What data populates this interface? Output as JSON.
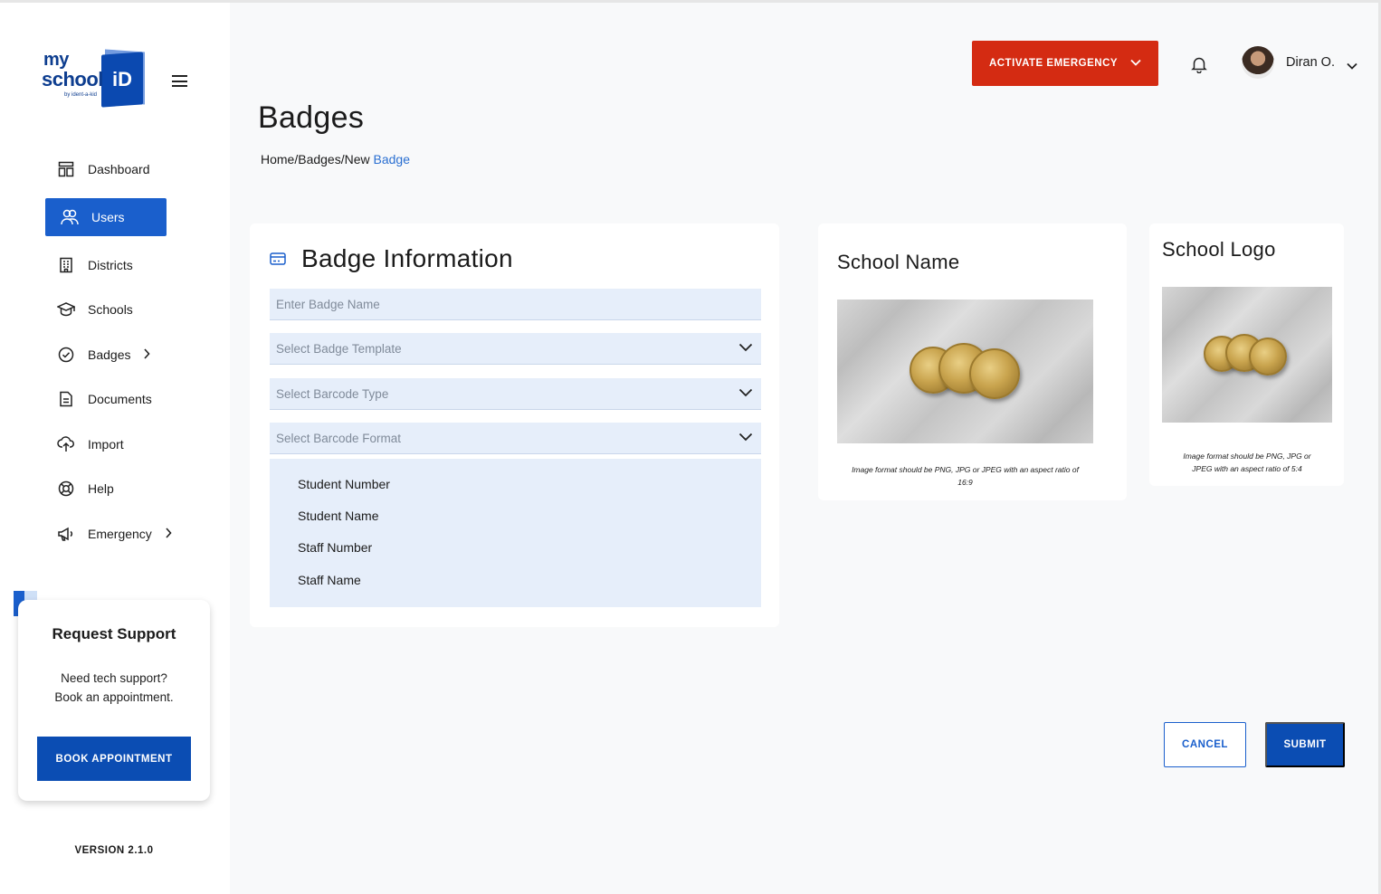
{
  "brand": {
    "logo_my": "my",
    "logo_school": "school",
    "logo_id": "iD",
    "logo_byline": "by ident-a-kid"
  },
  "sidebar": {
    "items": [
      {
        "label": "Dashboard",
        "icon": "dashboard-icon"
      },
      {
        "label": "Users",
        "icon": "users-icon",
        "active": true
      },
      {
        "label": "Districts",
        "icon": "building-icon"
      },
      {
        "label": "Schools",
        "icon": "graduation-cap-icon"
      },
      {
        "label": "Badges",
        "icon": "badge-check-icon",
        "has_submenu": true
      },
      {
        "label": "Documents",
        "icon": "document-icon"
      },
      {
        "label": "Import",
        "icon": "cloud-upload-icon"
      },
      {
        "label": "Help",
        "icon": "lifebuoy-icon"
      },
      {
        "label": "Emergency",
        "icon": "megaphone-icon",
        "has_submenu": true
      }
    ],
    "support": {
      "title": "Request Support",
      "line1": "Need tech support?",
      "line2": "Book an appointment.",
      "button": "BOOK APPOINTMENT"
    },
    "version": "VERSION 2.1.0"
  },
  "header": {
    "emergency_button": "ACTIVATE EMERGENCY",
    "user_name": "Diran O."
  },
  "page": {
    "title": "Badges",
    "breadcrumb": {
      "path": "Home/Badges/New ",
      "current": "Badge"
    }
  },
  "badge_info": {
    "title": "Badge Information",
    "badge_name_placeholder": "Enter Badge Name",
    "template_placeholder": "Select Badge Template",
    "barcode_type_placeholder": "Select Barcode Type",
    "barcode_format_placeholder": "Select Barcode Format",
    "format_options": [
      "Student Number",
      "Student Name",
      "Staff Number",
      "Staff Name"
    ]
  },
  "school_name_card": {
    "title": "School Name",
    "caption_line1": "Image format should be PNG, JPG or JPEG with an aspect ratio of",
    "caption_line2": "16:9"
  },
  "school_logo_card": {
    "title": "School Logo",
    "caption_line1": "Image format should be PNG, JPG or",
    "caption_line2": "JPEG with an aspect ratio of 5:4"
  },
  "actions": {
    "cancel": "CANCEL",
    "submit": "SUBMIT"
  },
  "colors": {
    "primary": "#1a5fcc",
    "primary_dark": "#0b4db3",
    "emergency": "#d42b12",
    "field_bg": "#e6eefa"
  }
}
